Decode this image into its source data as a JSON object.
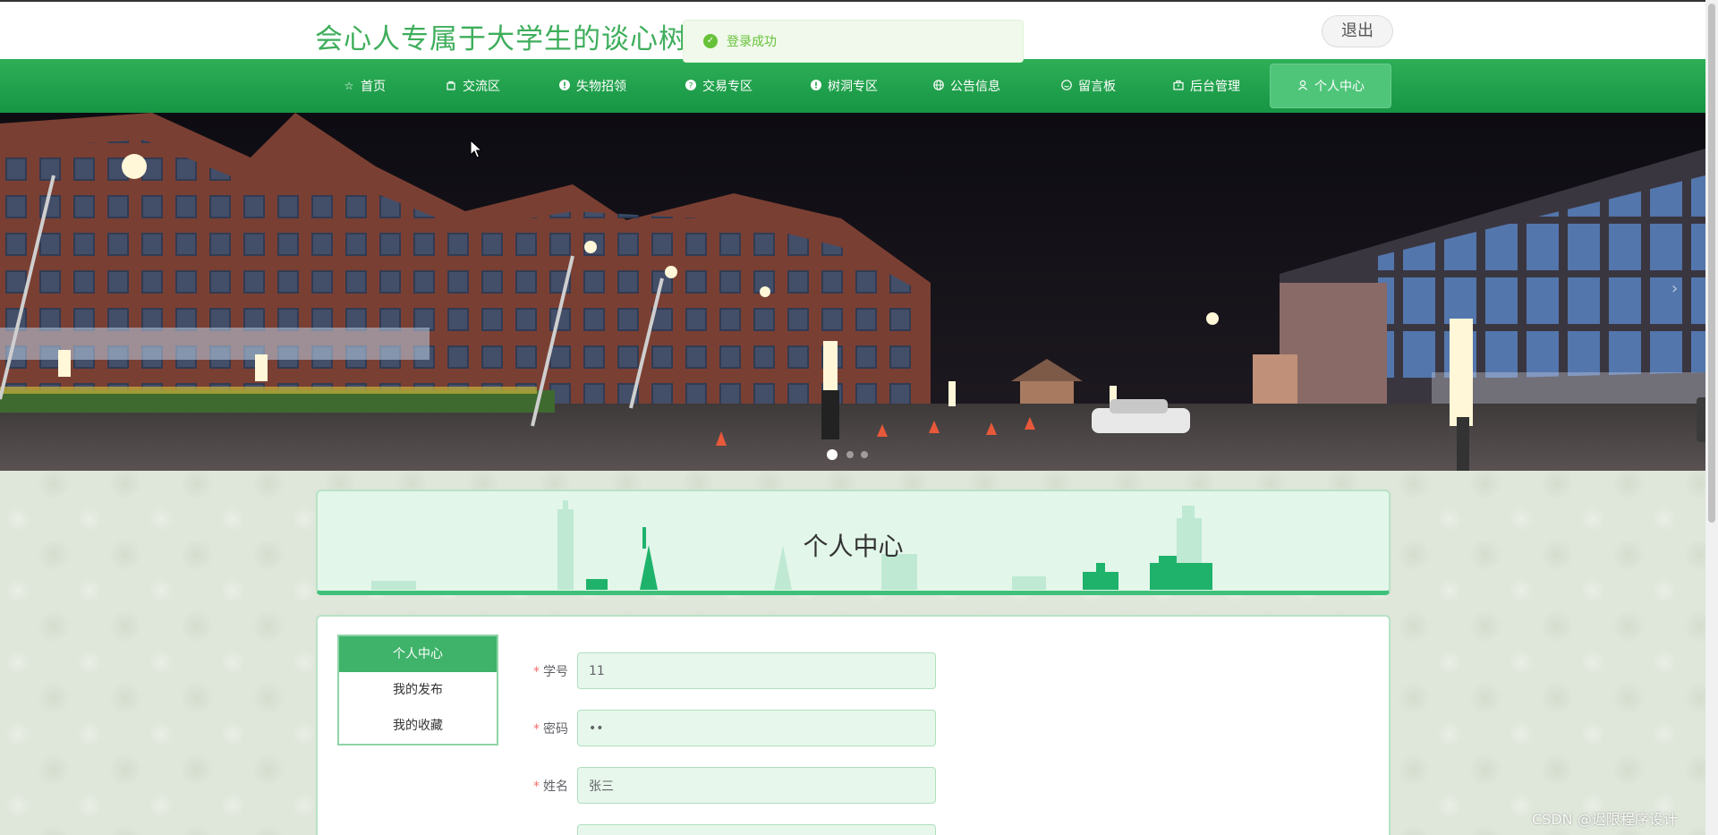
{
  "header": {
    "site_title": "会心人专属于大学生的谈心树洞",
    "logout_label": "退出"
  },
  "toast": {
    "message": "登录成功",
    "icon": "check-circle-icon",
    "color": "#67c23a"
  },
  "nav": {
    "items": [
      {
        "label": "首页",
        "icon": "star-icon"
      },
      {
        "label": "交流区",
        "icon": "bag-icon"
      },
      {
        "label": "失物招领",
        "icon": "info-icon"
      },
      {
        "label": "交易专区",
        "icon": "question-icon"
      },
      {
        "label": "树洞专区",
        "icon": "info-icon"
      },
      {
        "label": "公告信息",
        "icon": "globe-icon"
      },
      {
        "label": "留言板",
        "icon": "chat-icon"
      },
      {
        "label": "后台管理",
        "icon": "briefcase-icon"
      },
      {
        "label": "个人中心",
        "icon": "user-icon",
        "active": true
      }
    ],
    "accent": "#1fa24b"
  },
  "section": {
    "title": "个人中心"
  },
  "side_menu": {
    "items": [
      {
        "label": "个人中心",
        "active": true
      },
      {
        "label": "我的发布"
      },
      {
        "label": "我的收藏"
      }
    ]
  },
  "form": {
    "fields": [
      {
        "label": "学号",
        "required": true,
        "value": "11"
      },
      {
        "label": "密码",
        "required": true,
        "value": "••"
      },
      {
        "label": "姓名",
        "required": true,
        "value": "张三"
      },
      {
        "label": "",
        "required": false,
        "value": ""
      }
    ]
  },
  "watermark": "CSDN @迟限程序设计"
}
